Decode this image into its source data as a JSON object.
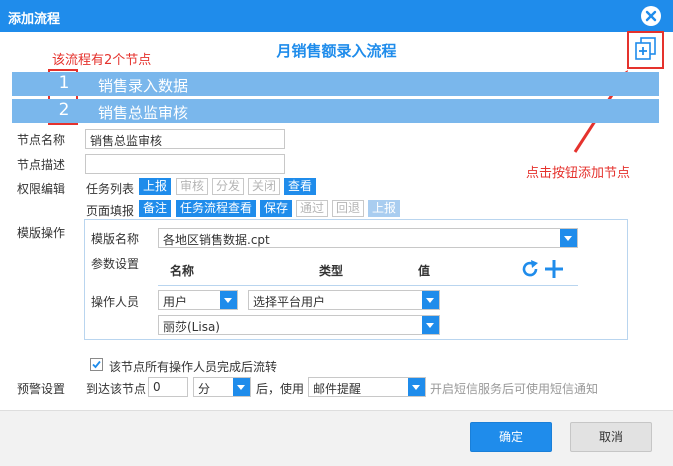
{
  "dialog": {
    "title": "添加流程"
  },
  "flow_title": "月销售额录入流程",
  "annotations": {
    "nodes_note": "该流程有2个节点",
    "add_note": "点击按钮添加节点"
  },
  "nodes": [
    {
      "number": "1",
      "name": "销售录入数据"
    },
    {
      "number": "2",
      "name": "销售总监审核"
    }
  ],
  "form": {
    "node_name": {
      "label": "节点名称",
      "value": "销售总监审核"
    },
    "node_desc": {
      "label": "节点描述",
      "value": ""
    },
    "permission": {
      "label": "权限编辑",
      "task_list_label": "任务列表",
      "task_list_tags": [
        {
          "text": "上报",
          "state": "on"
        },
        {
          "text": "审核",
          "state": "off"
        },
        {
          "text": "分发",
          "state": "off"
        },
        {
          "text": "关闭",
          "state": "off"
        },
        {
          "text": "查看",
          "state": "on"
        }
      ],
      "page_fill_label": "页面填报",
      "page_fill_tags": [
        {
          "text": "备注",
          "state": "on"
        },
        {
          "text": "任务流程查看",
          "state": "on"
        },
        {
          "text": "保存",
          "state": "on"
        },
        {
          "text": "通过",
          "state": "off"
        },
        {
          "text": "回退",
          "state": "off"
        },
        {
          "text": "上报",
          "state": "dis"
        }
      ]
    },
    "template": {
      "label": "模版操作",
      "template_name_label": "模版名称",
      "template_name_value": "各地区销售数据.cpt",
      "params_label": "参数设置",
      "param_headers": {
        "name": "名称",
        "type": "类型",
        "value": "值"
      },
      "operator_label": "操作人员",
      "operator_type": "用户",
      "operator_select": "选择平台用户",
      "operator_user": "丽莎(Lisa)"
    },
    "flow_checkbox_label": "该节点所有操作人员完成后流转",
    "warning": {
      "label": "预警设置",
      "reach_label": "到达该节点",
      "amount": "0",
      "unit": "分",
      "after_use_label": "后，使用",
      "method": "邮件提醒",
      "hint": "开启短信服务后可使用短信通知"
    }
  },
  "buttons": {
    "confirm": "确定",
    "cancel": "取消"
  },
  "colors": {
    "accent": "#1f8ceb",
    "node_bar": "#7ab7ec",
    "annotation": "#e5322d"
  }
}
